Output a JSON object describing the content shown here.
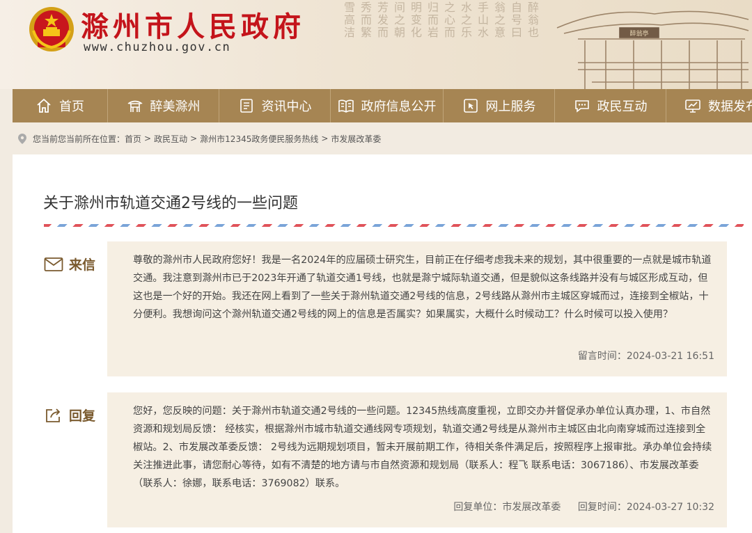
{
  "site": {
    "title": "滁州市人民政府",
    "url": "www.chuzhou.gov.cn",
    "plaque_text": "醉翁亭"
  },
  "calligraphy": {
    "columns": [
      "雪高洁",
      "秀而繁",
      "芳发而",
      "间之朝",
      "明变化",
      "归而岩",
      "之心而",
      "水之乐",
      "手山水",
      "翁之意",
      "自号曰",
      "醉翁也"
    ]
  },
  "nav": {
    "items": [
      {
        "label": "首页",
        "icon": "home-icon"
      },
      {
        "label": "醉美滁州",
        "icon": "pavilion-icon"
      },
      {
        "label": "资讯中心",
        "icon": "document-icon"
      },
      {
        "label": "政府信息公开",
        "icon": "book-icon"
      },
      {
        "label": "网上服务",
        "icon": "cursor-icon"
      },
      {
        "label": "政民互动",
        "icon": "chat-icon"
      },
      {
        "label": "数据发布",
        "icon": "monitor-icon"
      }
    ]
  },
  "breadcrumb": {
    "prefix": "您当前您当前所在位置：",
    "items": [
      "首页",
      "政民互动",
      "滁州市12345政务便民服务热线",
      "市发展改革委"
    ],
    "separator": ">"
  },
  "article": {
    "title": "关于滁州市轨道交通2号线的一些问题",
    "letter": {
      "label": "来信",
      "content": "尊敬的滁州市人民政府您好！我是一名2024年的应届硕士研究生，目前正在仔细考虑我未来的规划，其中很重要的一点就是城市轨道交通。我注意到滁州市已于2023年开通了轨道交通1号线，也就是滁宁城际轨道交通，但是貌似这条线路并没有与城区形成互动，但这也是一个好的开始。我还在网上看到了一些关于滁州轨道交通2号线的信息，2号线路从滁州市主城区穿城而过，连接到全椒站，十分便利。我想询问这个滁州轨道交通2号线的网上的信息是否属实？如果属实，大概什么时候动工？什么时候可以投入使用？",
      "time_label": "留言时间：",
      "time": "2024-03-21 16:51"
    },
    "reply": {
      "label": "回复",
      "content": "您好，您反映的问题：关于滁州市轨道交通2号线的一些问题。12345热线高度重视，立即交办并督促承办单位认真办理，1、市自然资源和规划局反馈： 经核实，根据滁州市城市轨道交通线网专项规划，轨道交通2号线是从滁州市主城区由北向南穿城而过连接到全椒站。2、市发展改革委反馈： 2号线为远期规划项目，暂未开展前期工作，待相关条件满足后，按照程序上报审批。承办单位会持续关注推进此事，请您耐心等待，如有不清楚的地方请与市自然资源和规划局（联系人：程飞 联系电话：3067186）、市发展改革委（联系人：徐娜，联系电话：3769082）联系。",
      "unit_label": "回复单位：",
      "unit": "市发展改革委",
      "time_label": "回复时间：",
      "time": "2024-03-27 10:32"
    }
  },
  "colors": {
    "brand_red": "#c4141b",
    "nav_bg": "#a68553",
    "label_brown": "#7a5a2e",
    "box_bg": "#f6efe3",
    "page_bg": "#f2ebe1"
  }
}
